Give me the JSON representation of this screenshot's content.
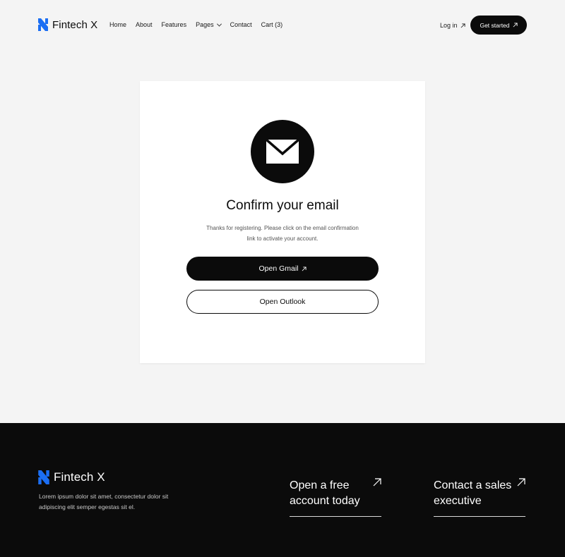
{
  "brand": {
    "name": "Fintech X",
    "accent": "#1b6ef3"
  },
  "nav": {
    "items": [
      {
        "label": "Home"
      },
      {
        "label": "About"
      },
      {
        "label": "Features"
      },
      {
        "label": "Pages",
        "has_dropdown": true
      },
      {
        "label": "Contact"
      },
      {
        "label": "Cart (3)"
      }
    ],
    "login_label": "Log in",
    "cta_label": "Get started"
  },
  "card": {
    "icon": "mail-icon",
    "title": "Confirm your email",
    "description": "Thanks for registering. Please click on the email confirmation link to activate your account.",
    "primary_button": "Open Gmail",
    "secondary_button": "Open Outlook"
  },
  "footer": {
    "brand": "Fintech X",
    "description": "Lorem ipsum dolor sit amet, consectetur dolor sit adipiscing elit semper egestas sit el.",
    "cta1": "Open a free account today",
    "cta2": "Contact a sales executive"
  }
}
